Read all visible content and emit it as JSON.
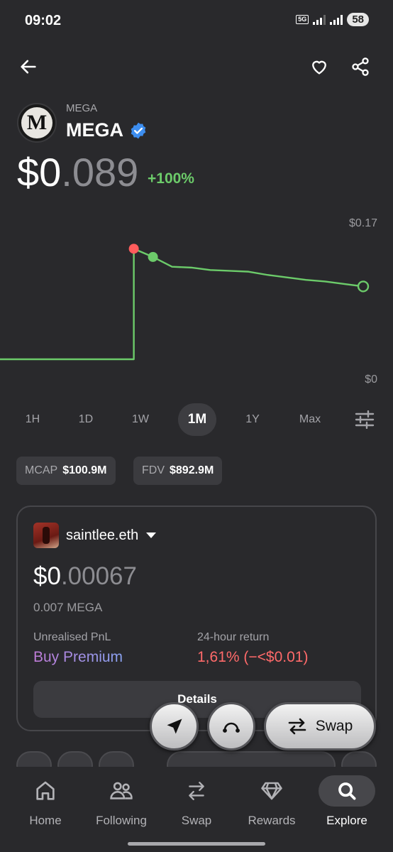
{
  "status_bar": {
    "time": "09:02",
    "network": "5G",
    "battery": "58"
  },
  "token": {
    "symbol": "MEGA",
    "name": "MEGA",
    "logo_letter": "M",
    "price_main": "$0",
    "price_decimals": ".089",
    "change": "+100%"
  },
  "chart_data": {
    "type": "line",
    "y_max_label": "$0.17",
    "y_min_label": "$0",
    "ylim": [
      0,
      0.17
    ],
    "series": [
      {
        "values": [
          0.0,
          0.0,
          0.0,
          0.0,
          0.0,
          0.0,
          0.0,
          0.135,
          0.125,
          0.113,
          0.112,
          0.109,
          0.108,
          0.107,
          0.103,
          0.1,
          0.097,
          0.095,
          0.092,
          0.089
        ],
        "color": "#6ccb6a"
      }
    ],
    "markers": {
      "high_color": "#ff5c5c",
      "point_color": "#6ccb6a"
    },
    "grid": false,
    "legend": "none"
  },
  "ranges": [
    "1H",
    "1D",
    "1W",
    "1M",
    "1Y",
    "Max"
  ],
  "selected_range": "1M",
  "stats": {
    "mcap_label": "MCAP",
    "mcap_value": "$100.9M",
    "fdv_label": "FDV",
    "fdv_value": "$892.9M"
  },
  "holding": {
    "wallet": "saintlee.eth",
    "value_main": "$0",
    "value_decimals": ".00067",
    "amount": "0.007 MEGA",
    "pnl_label": "Unrealised PnL",
    "pnl_value": "Buy Premium",
    "return_label": "24-hour return",
    "return_value": "1,61% (−<$0.01)",
    "details_label": "Details"
  },
  "actions": {
    "swap_label": "Swap"
  },
  "nav": [
    {
      "label": "Home",
      "icon": "home-icon"
    },
    {
      "label": "Following",
      "icon": "users-icon"
    },
    {
      "label": "Swap",
      "icon": "swap-arrows-icon"
    },
    {
      "label": "Rewards",
      "icon": "diamond-icon"
    },
    {
      "label": "Explore",
      "icon": "search-icon"
    }
  ],
  "active_nav": "Explore"
}
